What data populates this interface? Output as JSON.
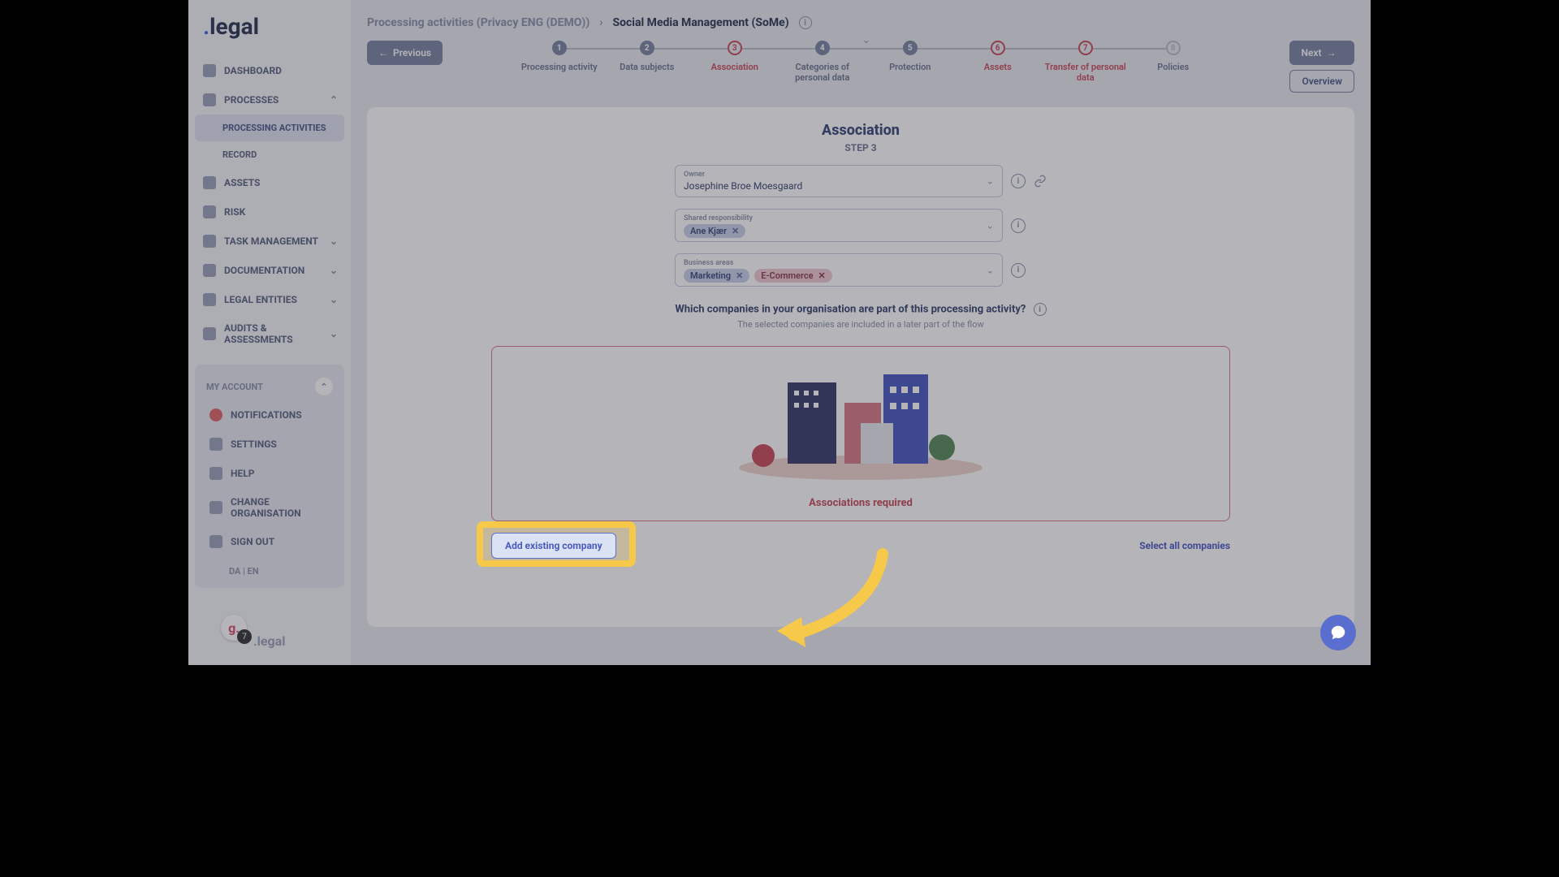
{
  "brand": {
    "name": ".legal"
  },
  "sidebar": {
    "items": [
      {
        "label": "DASHBOARD"
      },
      {
        "label": "PROCESSES"
      },
      {
        "label": "PROCESSING ACTIVITIES"
      },
      {
        "label": "RECORD"
      },
      {
        "label": "ASSETS"
      },
      {
        "label": "RISK"
      },
      {
        "label": "TASK MANAGEMENT"
      },
      {
        "label": "DOCUMENTATION"
      },
      {
        "label": "LEGAL ENTITIES"
      },
      {
        "label": "AUDITS & ASSESSMENTS"
      }
    ],
    "account_title": "MY ACCOUNT",
    "account_items": [
      {
        "label": "NOTIFICATIONS"
      },
      {
        "label": "SETTINGS"
      },
      {
        "label": "HELP"
      },
      {
        "label": "CHANGE ORGANISATION"
      },
      {
        "label": "SIGN OUT"
      }
    ],
    "lang": "DA   |   EN",
    "g_badge": "g.",
    "g_count": "7",
    "footer_logo": ".legal"
  },
  "breadcrumb": {
    "parent": "Processing activities (Privacy ENG (DEMO))",
    "current": "Social Media Management (SoMe)"
  },
  "nav_buttons": {
    "previous": "Previous",
    "next": "Next",
    "overview": "Overview"
  },
  "steps": [
    {
      "n": "1",
      "label": "Processing activity",
      "state": "done"
    },
    {
      "n": "2",
      "label": "Data subjects",
      "state": "done"
    },
    {
      "n": "3",
      "label": "Association",
      "state": "active"
    },
    {
      "n": "4",
      "label": "Categories of personal data",
      "state": "done"
    },
    {
      "n": "5",
      "label": "Protection",
      "state": "done"
    },
    {
      "n": "6",
      "label": "Assets",
      "state": "error"
    },
    {
      "n": "7",
      "label": "Transfer of personal data",
      "state": "error"
    },
    {
      "n": "8",
      "label": "Policies",
      "state": "pending"
    }
  ],
  "card": {
    "title": "Association",
    "step_label": "STEP 3",
    "owner_label": "Owner",
    "owner_value": "Josephine Broe Moesgaard",
    "shared_label": "Shared responsibility",
    "shared_chips": [
      "Ane Kjær"
    ],
    "areas_label": "Business areas",
    "areas_chips": [
      {
        "text": "Marketing",
        "tone": "blue"
      },
      {
        "text": "E-Commerce",
        "tone": "pink"
      }
    ],
    "question": "Which companies in your organisation are part of this processing activity?",
    "subtext": "The selected companies are included in a later part of the flow",
    "assoc_required": "Associations required",
    "add_btn": "Add existing company",
    "select_all": "Select all companies"
  }
}
